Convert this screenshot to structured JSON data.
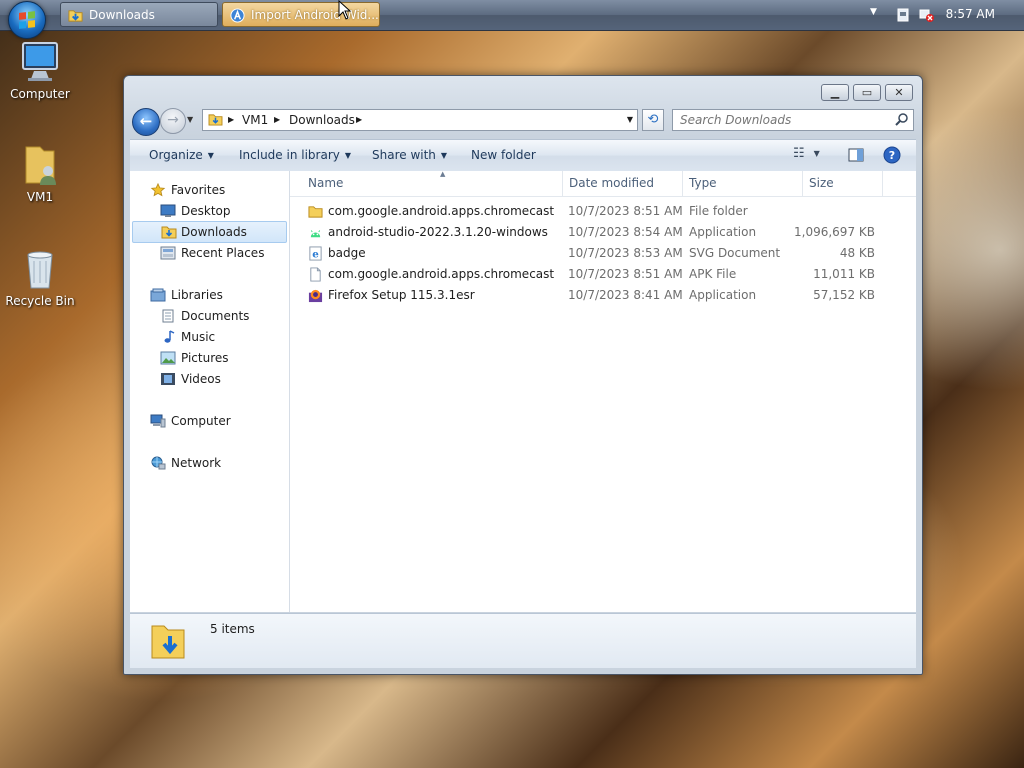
{
  "taskbar": {
    "buttons": [
      {
        "label": "Downloads",
        "icon": "folder-icon"
      },
      {
        "label": "Import Android Wid...",
        "icon": "android-studio-icon"
      }
    ],
    "clock": "8:57 AM"
  },
  "desktop": {
    "icons": [
      {
        "label": "Computer",
        "icon": "computer-icon"
      },
      {
        "label": "VM1",
        "icon": "user-folder-icon"
      },
      {
        "label": "Recycle Bin",
        "icon": "recycle-bin-icon"
      }
    ]
  },
  "window": {
    "address": {
      "crumbs": [
        "VM1",
        "Downloads"
      ]
    },
    "search": {
      "placeholder": "Search Downloads"
    },
    "toolbar": {
      "organize": "Organize",
      "include_in_library": "Include in library",
      "share_with": "Share with",
      "new_folder": "New folder"
    },
    "navpane": {
      "favorites": "Favorites",
      "desktop": "Desktop",
      "downloads": "Downloads",
      "recent_places": "Recent Places",
      "libraries": "Libraries",
      "documents": "Documents",
      "music": "Music",
      "pictures": "Pictures",
      "videos": "Videos",
      "computer": "Computer",
      "network": "Network"
    },
    "columns": {
      "name": "Name",
      "date": "Date modified",
      "type": "Type",
      "size": "Size"
    },
    "files": [
      {
        "name": "com.google.android.apps.chromecast.ap...",
        "date": "10/7/2023 8:51 AM",
        "type": "File folder",
        "size": "",
        "icon": "folder-icon"
      },
      {
        "name": "android-studio-2022.3.1.20-windows",
        "date": "10/7/2023 8:54 AM",
        "type": "Application",
        "size": "1,096,697 KB",
        "icon": "android-studio-icon"
      },
      {
        "name": "badge",
        "date": "10/7/2023 8:53 AM",
        "type": "SVG Document",
        "size": "48 KB",
        "icon": "ie-document-icon"
      },
      {
        "name": "com.google.android.apps.chromecast.ap...",
        "date": "10/7/2023 8:51 AM",
        "type": "APK File",
        "size": "11,011 KB",
        "icon": "blank-file-icon"
      },
      {
        "name": "Firefox Setup 115.3.1esr",
        "date": "10/7/2023 8:41 AM",
        "type": "Application",
        "size": "57,152 KB",
        "icon": "firefox-setup-icon"
      }
    ],
    "status": {
      "item_count": "5 items"
    }
  },
  "colors": {
    "accent": "#1e395b",
    "selection": "#d2e6fa"
  }
}
